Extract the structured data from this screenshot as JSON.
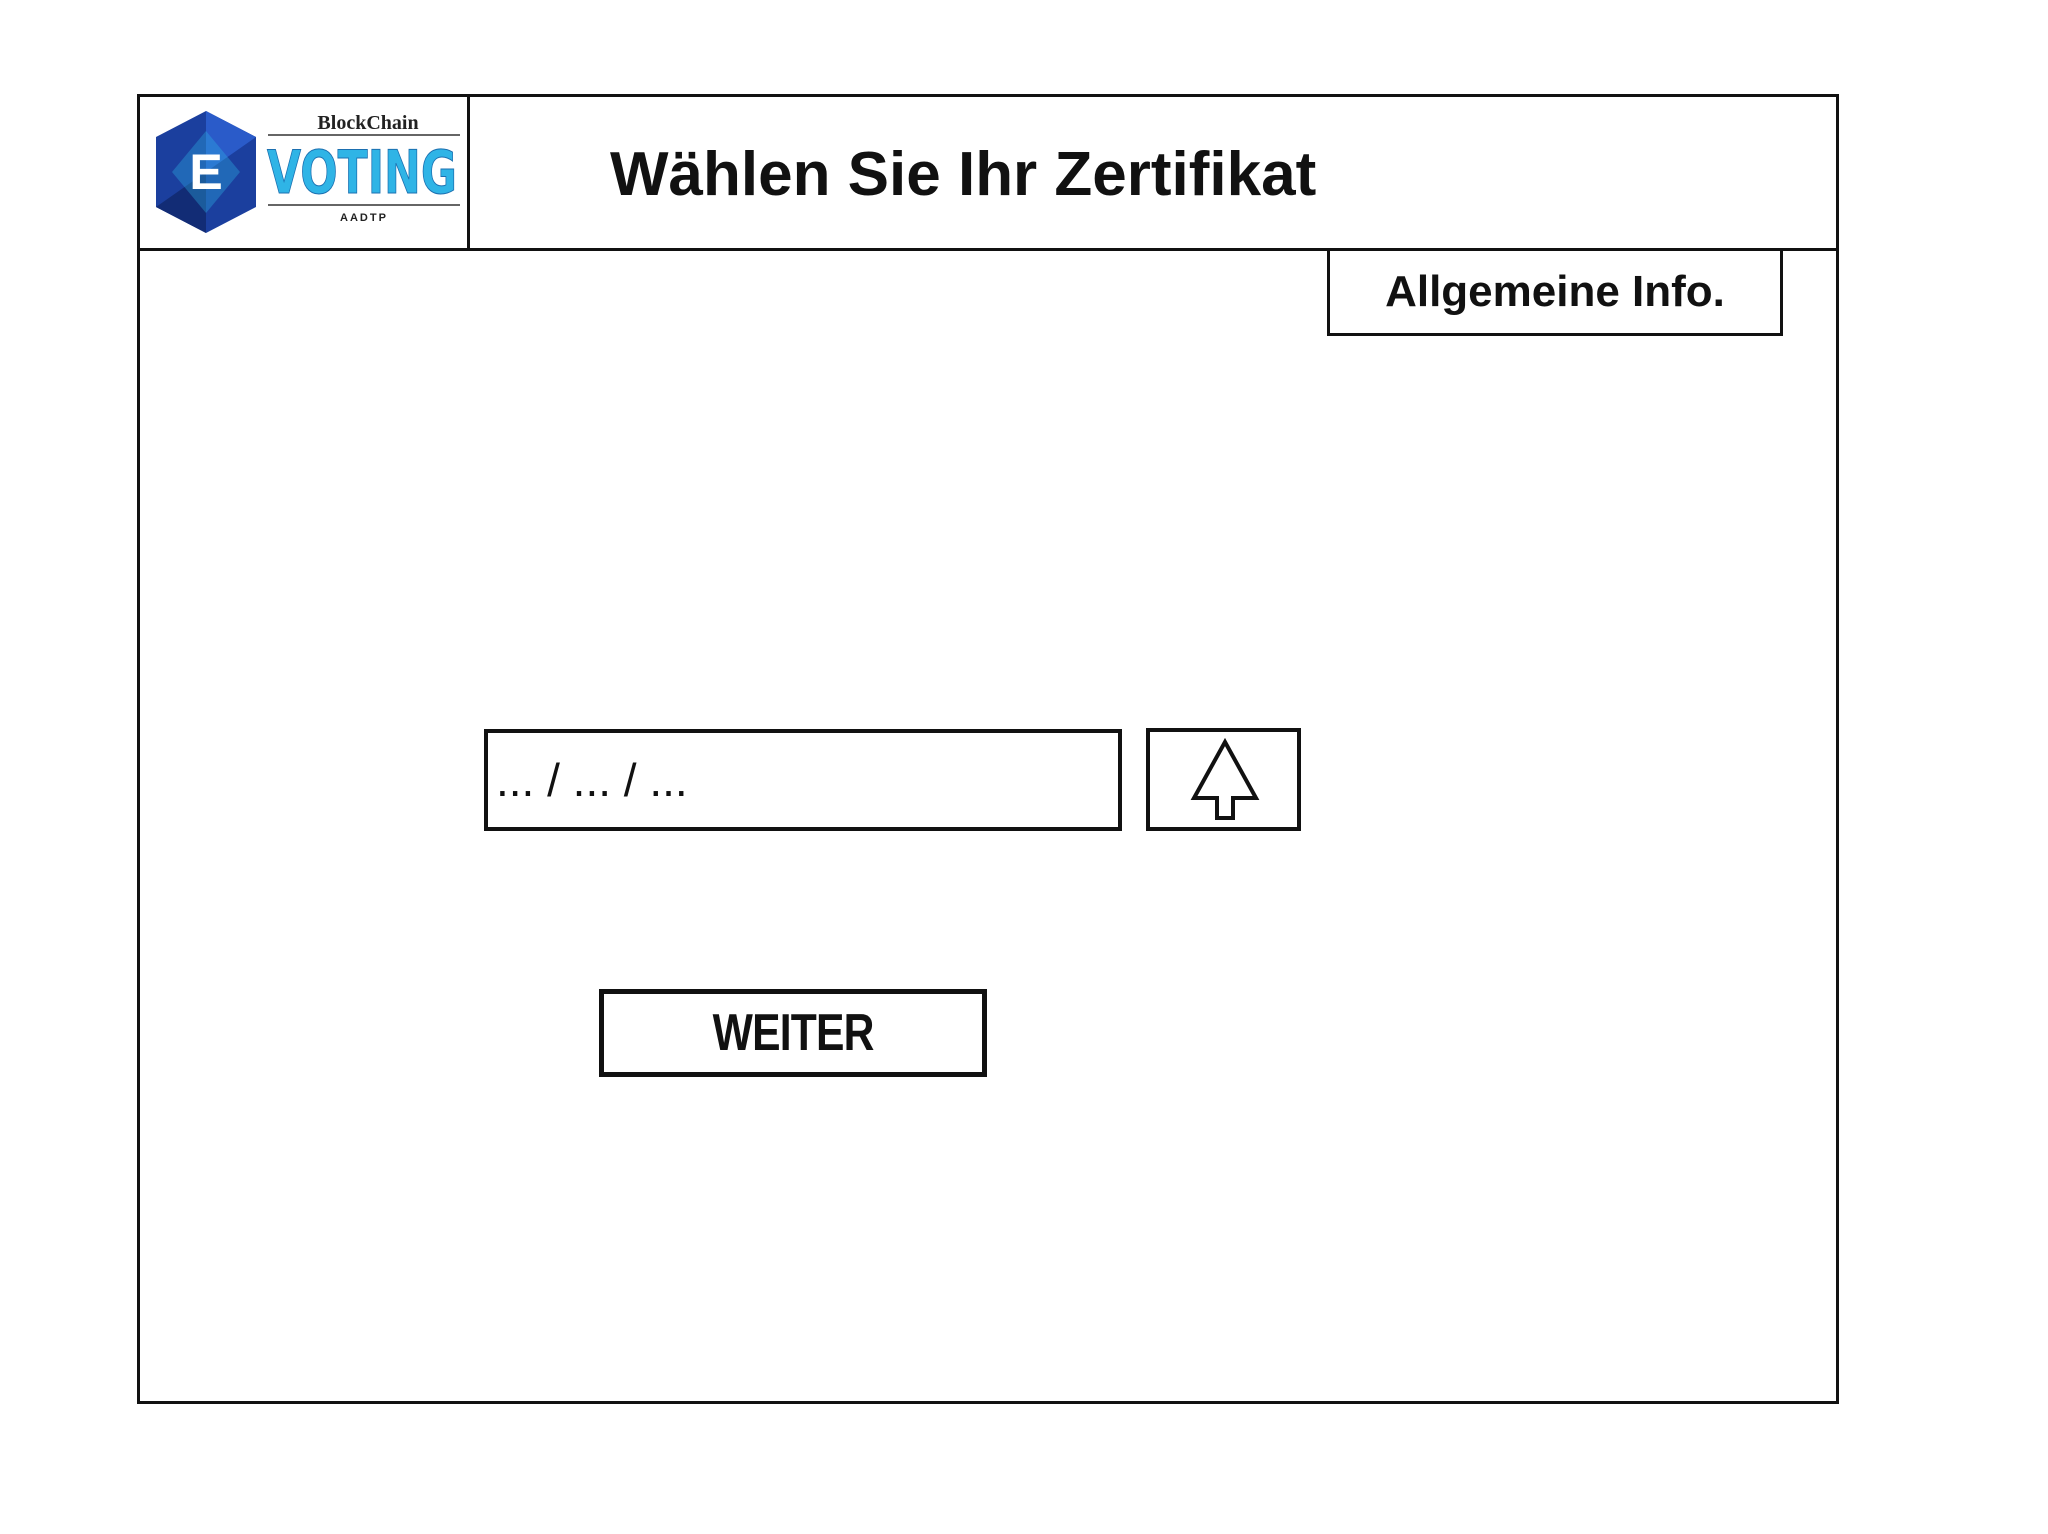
{
  "header": {
    "logo": {
      "top_text": "BlockChain",
      "letter": "E",
      "main_text": "VOTING",
      "sub_text": "AADTP"
    },
    "title": "Wählen Sie Ihr Zertifikat"
  },
  "toolbar": {
    "info_label": "Allgemeine Info."
  },
  "upload": {
    "path_placeholder": "... / ... / ...",
    "upload_icon": "upload-arrow-icon"
  },
  "actions": {
    "next_label": "WEITER"
  },
  "colors": {
    "border": "#111111",
    "logo_blue_dark": "#1b3f9e",
    "logo_blue_light": "#2fb4e6"
  }
}
